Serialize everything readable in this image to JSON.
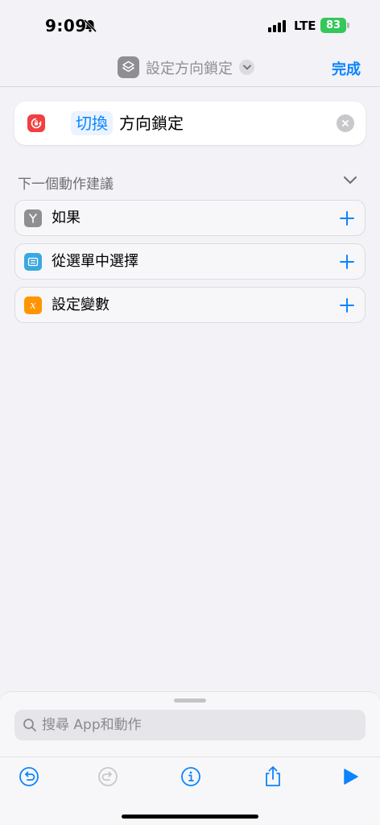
{
  "status": {
    "time": "9:09",
    "network": "LTE",
    "battery": "83"
  },
  "nav": {
    "title": "設定方向鎖定",
    "done_label": "完成"
  },
  "action": {
    "param": "切換",
    "label": "方向鎖定"
  },
  "suggestions": {
    "header": "下一個動作建議",
    "items": [
      {
        "label": "如果",
        "icon": "branch-icon",
        "color": "#8e8e93"
      },
      {
        "label": "從選單中選擇",
        "icon": "menu-list-icon",
        "color": "#3aa8e0"
      },
      {
        "label": "設定變數",
        "icon": "variable-icon",
        "color": "#ff9500"
      }
    ]
  },
  "search": {
    "placeholder": "搜尋 App和動作"
  },
  "toolbar": {
    "icons": [
      "undo-icon",
      "redo-icon",
      "info-icon",
      "share-icon",
      "play-icon"
    ]
  },
  "colors": {
    "accent": "#0a84ff",
    "background": "#f2f2f7",
    "action_icon": "#f23f3f",
    "battery": "#34c759"
  }
}
